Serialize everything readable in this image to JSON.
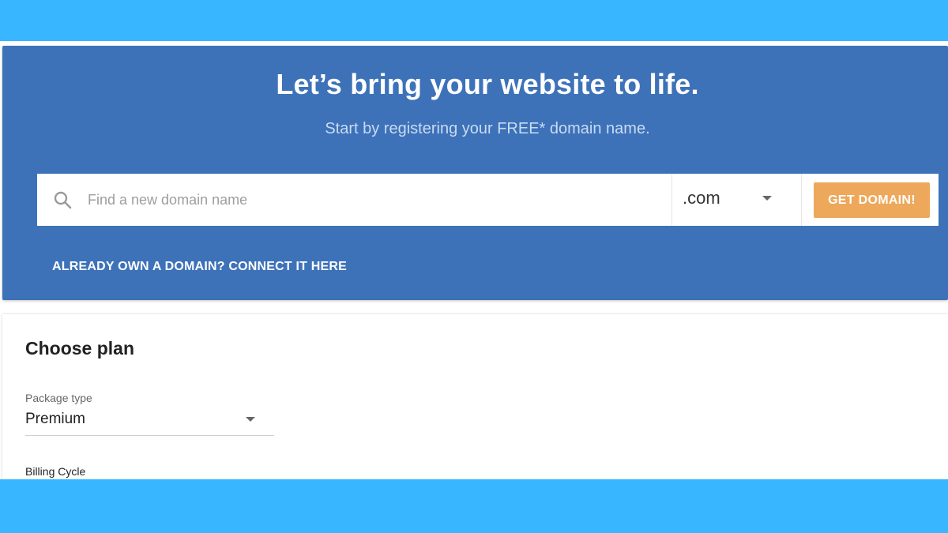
{
  "hero": {
    "title": "Let’s bring your website to life.",
    "subtitle": "Start by registering your FREE* domain name.",
    "search": {
      "placeholder": "Find a new domain name",
      "value": "",
      "tld": ".com",
      "button_label": "GET DOMAIN!",
      "icon": "search-icon"
    },
    "connect_link": "ALREADY OWN A DOMAIN? CONNECT IT HERE"
  },
  "plan": {
    "title": "Choose plan",
    "package_label": "Package type",
    "package_value": "Premium",
    "billing_label": "Billing Cycle"
  },
  "colors": {
    "band": "#38b6ff",
    "hero_bg": "#3d72b9",
    "button": "#eda85b"
  }
}
